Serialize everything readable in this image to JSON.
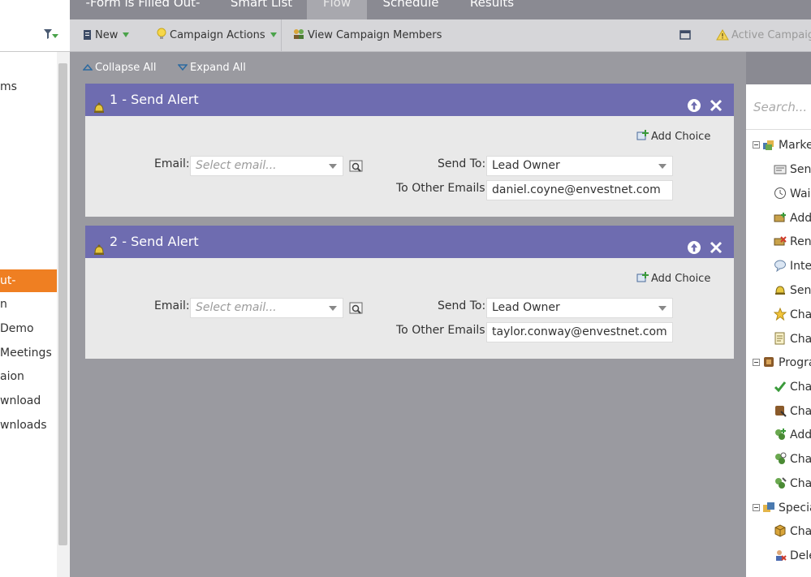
{
  "tabs": [
    {
      "label": "-Form is Filled Out-"
    },
    {
      "label": "Smart List"
    },
    {
      "label": "Flow"
    },
    {
      "label": "Schedule"
    },
    {
      "label": "Results"
    }
  ],
  "toolbar": {
    "new_label": "New",
    "campaign_actions_label": "Campaign Actions",
    "view_members_label": "View Campaign Members",
    "active_campaign_label": "Active Campaign"
  },
  "left_tree": {
    "items": [
      {
        "label": "ms"
      },
      {
        "label": "ut-"
      },
      {
        "label": "n"
      },
      {
        "label": "Demo"
      },
      {
        "label": "Meetings"
      },
      {
        "label": "aion"
      },
      {
        "label": "wnload"
      },
      {
        "label": "wnloads"
      }
    ]
  },
  "controls": {
    "collapse_all": "Collapse All",
    "expand_all": "Expand All"
  },
  "flow_steps": [
    {
      "title": "1 - Send Alert",
      "add_choice": "Add Choice",
      "email_label": "Email:",
      "email_placeholder": "Select email...",
      "send_to_label": "Send To:",
      "send_to_value": "Lead Owner",
      "other_emails_label": "To Other Emails:",
      "other_emails_value": "daniel.coyne@envestnet.com"
    },
    {
      "title": "2 - Send Alert",
      "add_choice": "Add Choice",
      "email_label": "Email:",
      "email_placeholder": "Select email...",
      "send_to_label": "Send To:",
      "send_to_value": "Lead Owner",
      "other_emails_label": "To Other Emails:",
      "other_emails_value": "taylor.conway@envestnet.com"
    }
  ],
  "palette": {
    "search_placeholder": "Search...",
    "items": [
      {
        "label": "Marke",
        "group": true
      },
      {
        "label": "Sen"
      },
      {
        "label": "Wai"
      },
      {
        "label": "Add"
      },
      {
        "label": "Ren"
      },
      {
        "label": "Inte"
      },
      {
        "label": "Sen"
      },
      {
        "label": "Cha"
      },
      {
        "label": "Cha"
      },
      {
        "label": "Progra",
        "group": true
      },
      {
        "label": "Cha"
      },
      {
        "label": "Cha"
      },
      {
        "label": "Add"
      },
      {
        "label": "Cha"
      },
      {
        "label": "Cha"
      },
      {
        "label": "Specia",
        "group": true
      },
      {
        "label": "Cha"
      },
      {
        "label": "Dele"
      }
    ]
  },
  "colors": {
    "header_purple": "#6e6cb0",
    "active_orange": "#ef7f22",
    "caret_green": "#4aa34a"
  }
}
